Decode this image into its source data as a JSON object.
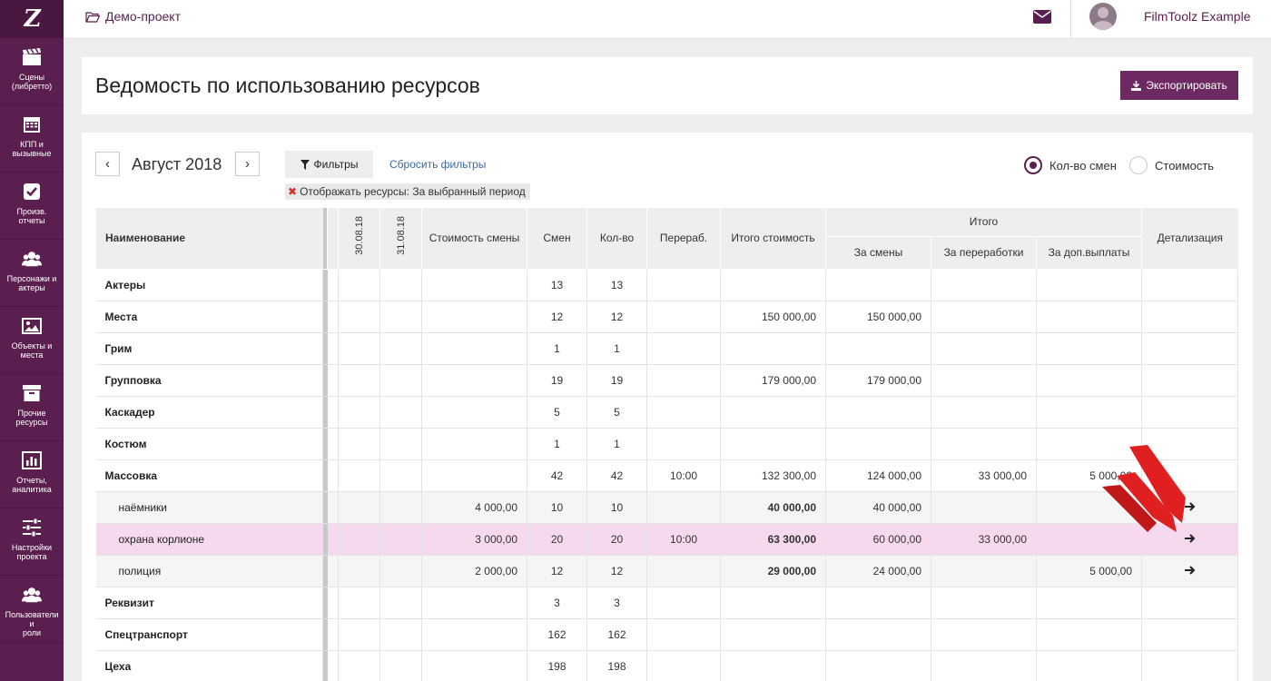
{
  "sidebar": {
    "logo": "Z",
    "items": [
      {
        "label": "Сцены\n(либретто)",
        "icon": "clapperboard-icon"
      },
      {
        "label": "КПП и\nвызывные",
        "icon": "calendar-icon"
      },
      {
        "label": "Произв.\nотчеты",
        "icon": "checkbox-icon"
      },
      {
        "label": "Персонажи и\nактеры",
        "icon": "users-icon"
      },
      {
        "label": "Объекты и\nместа",
        "icon": "image-icon"
      },
      {
        "label": "Прочие\nресурсы",
        "icon": "archive-icon"
      },
      {
        "label": "Отчеты,\nаналитика",
        "icon": "bar-chart-icon"
      },
      {
        "label": "Настройки\nпроекта",
        "icon": "sliders-icon"
      },
      {
        "label": "Пользователи и\nроли",
        "icon": "users-icon"
      }
    ]
  },
  "topbar": {
    "project": "Демо-проект",
    "user_name": "FilmToolz Example"
  },
  "header": {
    "title": "Ведомость по использованию ресурсов",
    "export_label": "Экспортировать"
  },
  "controls": {
    "prev": "‹",
    "next": "›",
    "month": "Август 2018",
    "filters_label": "Фильтры",
    "reset_label": "Сбросить фильтры",
    "chip_label": "Отображать ресурсы:",
    "chip_value": "За выбранный период",
    "radio_shifts": "Кол-во смен",
    "radio_cost": "Стоимость",
    "selected_mode": "shifts"
  },
  "table": {
    "headers": {
      "name": "Наименование",
      "date1": "30.08.18",
      "date2": "31.08.18",
      "shift_cost": "Стоимость смены",
      "shifts": "Смен",
      "qty": "Кол-во",
      "overtime": "Перераб.",
      "total_cost": "Итого стоимость",
      "total_group": "Итого",
      "for_shifts": "За смены",
      "for_overtime": "За переработки",
      "for_extra": "За доп.выплаты",
      "details": "Детализация"
    },
    "rows": [
      {
        "name": "Актеры",
        "shift_cost": "",
        "shifts": "13",
        "qty": "13",
        "overtime": "",
        "total": "",
        "for_shifts": "",
        "for_overtime": "",
        "for_extra": "",
        "sub": false
      },
      {
        "name": "Места",
        "shift_cost": "",
        "shifts": "12",
        "qty": "12",
        "overtime": "",
        "total": "150 000,00",
        "for_shifts": "150 000,00",
        "for_overtime": "",
        "for_extra": "",
        "sub": false
      },
      {
        "name": "Грим",
        "shift_cost": "",
        "shifts": "1",
        "qty": "1",
        "overtime": "",
        "total": "",
        "for_shifts": "",
        "for_overtime": "",
        "for_extra": "",
        "sub": false
      },
      {
        "name": "Групповка",
        "shift_cost": "",
        "shifts": "19",
        "qty": "19",
        "overtime": "",
        "total": "179 000,00",
        "for_shifts": "179 000,00",
        "for_overtime": "",
        "for_extra": "",
        "sub": false
      },
      {
        "name": "Каскадер",
        "shift_cost": "",
        "shifts": "5",
        "qty": "5",
        "overtime": "",
        "total": "",
        "for_shifts": "",
        "for_overtime": "",
        "for_extra": "",
        "sub": false
      },
      {
        "name": "Костюм",
        "shift_cost": "",
        "shifts": "1",
        "qty": "1",
        "overtime": "",
        "total": "",
        "for_shifts": "",
        "for_overtime": "",
        "for_extra": "",
        "sub": false
      },
      {
        "name": "Массовка",
        "shift_cost": "",
        "shifts": "42",
        "qty": "42",
        "overtime": "10:00",
        "total": "132 300,00",
        "for_shifts": "124 000,00",
        "for_overtime": "33 000,00",
        "for_extra": "5 000,00",
        "sub": false
      },
      {
        "name": "наёмники",
        "shift_cost": "4 000,00",
        "shifts": "10",
        "qty": "10",
        "overtime": "",
        "total": "40 000,00",
        "for_shifts": "40 000,00",
        "for_overtime": "",
        "for_extra": "",
        "sub": true,
        "arrow": true
      },
      {
        "name": "охрана корлионе",
        "shift_cost": "3 000,00",
        "shifts": "20",
        "qty": "20",
        "overtime": "10:00",
        "total": "63 300,00",
        "for_shifts": "60 000,00",
        "for_overtime": "33 000,00",
        "for_extra": "",
        "sub": true,
        "arrow": true,
        "highlight": true
      },
      {
        "name": "полиция",
        "shift_cost": "2 000,00",
        "shifts": "12",
        "qty": "12",
        "overtime": "",
        "total": "29 000,00",
        "for_shifts": "24 000,00",
        "for_overtime": "",
        "for_extra": "5 000,00",
        "sub": true,
        "arrow": true
      },
      {
        "name": "Реквизит",
        "shift_cost": "",
        "shifts": "3",
        "qty": "3",
        "overtime": "",
        "total": "",
        "for_shifts": "",
        "for_overtime": "",
        "for_extra": "",
        "sub": false
      },
      {
        "name": "Спецтранспорт",
        "shift_cost": "",
        "shifts": "162",
        "qty": "162",
        "overtime": "",
        "total": "",
        "for_shifts": "",
        "for_overtime": "",
        "for_extra": "",
        "sub": false
      },
      {
        "name": "Цеха",
        "shift_cost": "",
        "shifts": "198",
        "qty": "198",
        "overtime": "",
        "total": "",
        "for_shifts": "",
        "for_overtime": "",
        "for_extra": "",
        "sub": false
      }
    ]
  },
  "colors": {
    "brand": "#5a1f4f",
    "button": "#6d2a62",
    "highlight_row": "#f6d9ee",
    "link": "#3b6aa0",
    "annotation_arrow": "#e02020"
  }
}
